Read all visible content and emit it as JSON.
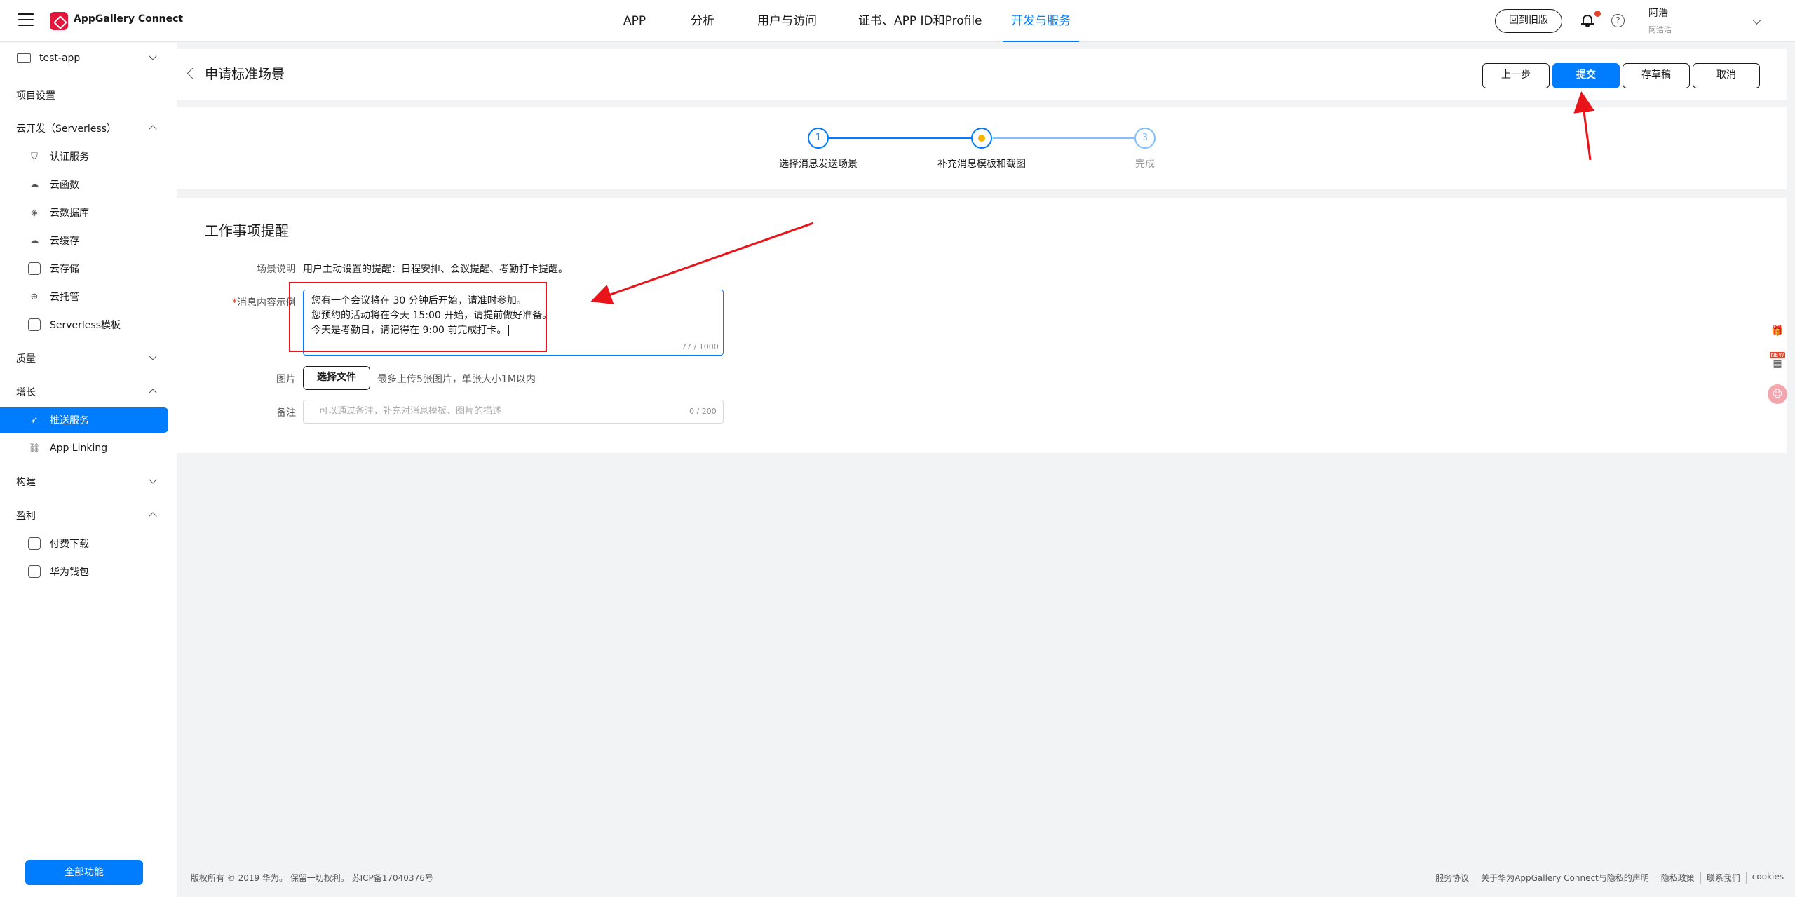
{
  "header": {
    "brand": "AppGallery Connect",
    "nav": [
      "APP",
      "分析",
      "用户与访问",
      "证书、APP ID和Profile",
      "开发与服务"
    ],
    "old_version": "回到旧版",
    "help": "?",
    "user_name": "阿浩",
    "user_sub": "阿浩浩"
  },
  "sidebar": {
    "project": "test-app",
    "items": [
      {
        "label": "项目设置"
      },
      {
        "label": "云开发（Serverless）"
      },
      {
        "label": "认证服务"
      },
      {
        "label": "云函数"
      },
      {
        "label": "云数据库"
      },
      {
        "label": "云缓存"
      },
      {
        "label": "云存储"
      },
      {
        "label": "云托管"
      },
      {
        "label": "Serverless模板"
      },
      {
        "label": "质量"
      },
      {
        "label": "增长"
      },
      {
        "label": "推送服务"
      },
      {
        "label": "App Linking"
      },
      {
        "label": "构建"
      },
      {
        "label": "盈利"
      },
      {
        "label": "付费下载"
      },
      {
        "label": "华为钱包"
      }
    ],
    "all_features": "全部功能"
  },
  "page": {
    "title": "申请标准场景",
    "buttons": {
      "prev": "上一步",
      "submit": "提交",
      "draft": "存草稿",
      "cancel": "取消"
    }
  },
  "steps": [
    {
      "num": "1",
      "label": "选择消息发送场景",
      "state": "done"
    },
    {
      "num": "",
      "label": "补充消息模板和截图",
      "state": "current"
    },
    {
      "num": "3",
      "label": "完成",
      "state": "pending"
    }
  ],
  "form": {
    "section_title": "工作事项提醒",
    "scene_label": "场景说明",
    "scene_value": "用户主动设置的提醒：日程安排、会议提醒、考勤打卡提醒。",
    "required_mark": "*",
    "content_label": "消息内容示例",
    "content_lines": [
      "您有一个会议将在 30 分钟后开始，请准时参加。",
      "您预约的活动将在今天 15:00 开始，请提前做好准备。",
      "今天是考勤日，请记得在 9:00 前完成打卡。"
    ],
    "content_counter": "77 / 1000",
    "image_label": "图片",
    "image_button": "选择文件",
    "image_hint": "最多上传5张图片，单张大小1M以内",
    "note_label": "备注",
    "note_placeholder": "可以通过备注，补充对消息模板、图片的描述",
    "note_counter": "0 / 200"
  },
  "floating": {
    "new_badge": "NEW"
  },
  "footer": {
    "copyright": "版权所有 © 2019 华为。 保留一切权利。 苏ICP备17040376号",
    "links": [
      "服务协议",
      "关于华为AppGallery Connect与隐私的声明",
      "隐私政策",
      "联系我们",
      "cookies"
    ]
  },
  "colors": {
    "accent": "#007dff",
    "annotation": "#e8141a",
    "step_current": "#f7b500"
  }
}
